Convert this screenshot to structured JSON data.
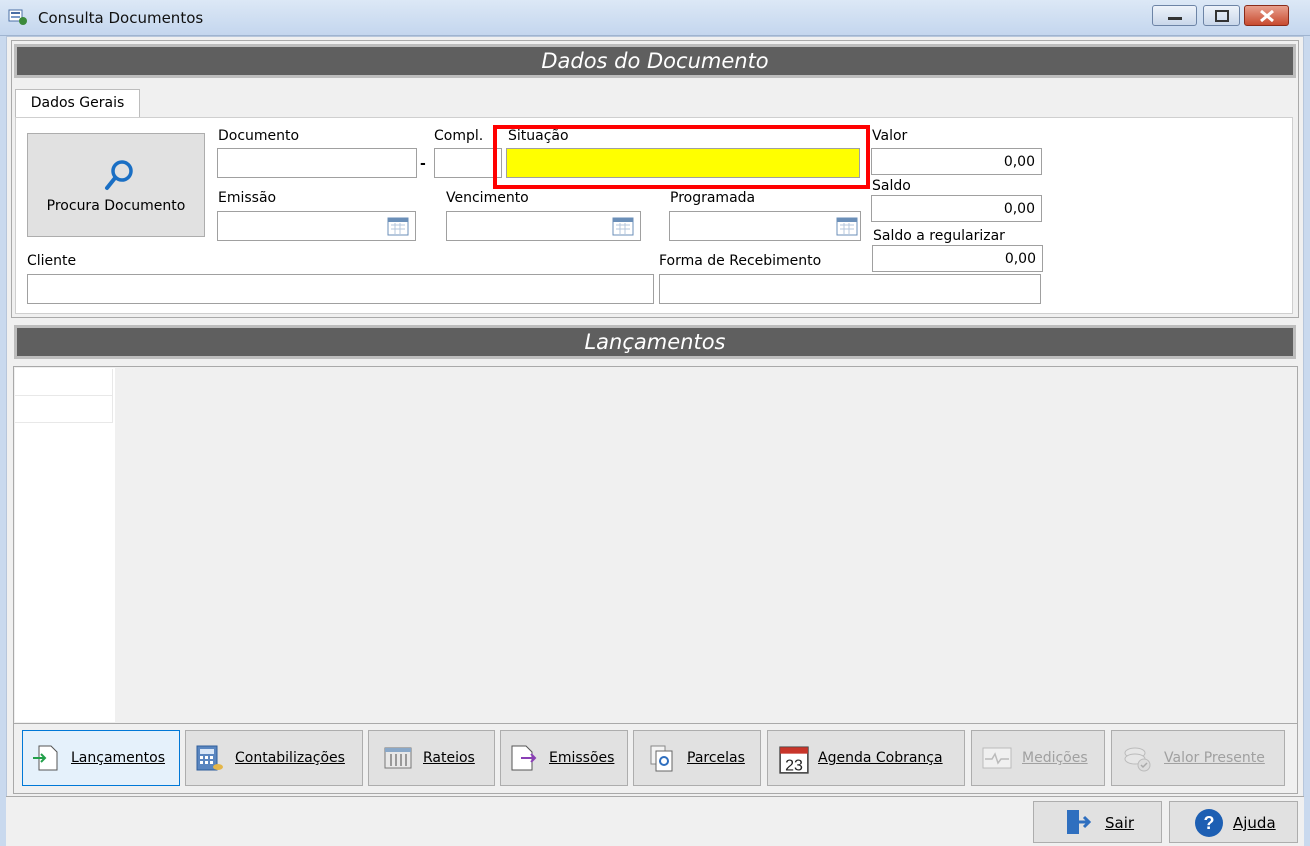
{
  "window": {
    "title": "Consulta Documentos"
  },
  "sections": {
    "document_header": "Dados do Documento",
    "entries_header": "Lançamentos"
  },
  "tabs": [
    {
      "label": "Dados Gerais",
      "active": true
    }
  ],
  "search_button": {
    "label": "Procura Documento"
  },
  "fields": {
    "documento": {
      "label": "Documento",
      "value": ""
    },
    "compl": {
      "label": "Compl.",
      "value": ""
    },
    "separator": "-",
    "situacao": {
      "label": "Situação",
      "value": "",
      "background": "#ffff00"
    },
    "valor": {
      "label": "Valor",
      "value": "0,00"
    },
    "saldo": {
      "label": "Saldo",
      "value": "0,00"
    },
    "saldo_regularizar": {
      "label": "Saldo a regularizar",
      "value": "0,00"
    },
    "emissao": {
      "label": "Emissão",
      "value": ""
    },
    "vencimento": {
      "label": "Vencimento",
      "value": ""
    },
    "programada": {
      "label": "Programada",
      "value": ""
    },
    "cliente": {
      "label": "Cliente",
      "value": ""
    },
    "forma_recebimento": {
      "label": "Forma de Recebimento",
      "value": ""
    }
  },
  "toolbar": [
    {
      "label": "Lançamentos",
      "icon": "entries-icon",
      "active": true,
      "enabled": true
    },
    {
      "label": "Contabilizações",
      "icon": "calculator-icon",
      "enabled": true
    },
    {
      "label": "Rateios",
      "icon": "split-icon",
      "enabled": true
    },
    {
      "label": "Emissões",
      "icon": "emissions-icon",
      "enabled": true
    },
    {
      "label": "Parcelas",
      "icon": "installments-icon",
      "enabled": true
    },
    {
      "label": "Agenda Cobrança",
      "icon": "calendar-icon",
      "calendar_day": "23",
      "enabled": true
    },
    {
      "label": "Medições",
      "icon": "measurement-icon",
      "enabled": false
    },
    {
      "label": "Valor Presente",
      "icon": "present-value-icon",
      "enabled": false
    }
  ],
  "footer": {
    "exit_label": "Sair",
    "help_label": "Ajuda"
  },
  "colors": {
    "header_bar": "#5f5f5f",
    "highlight": "#ff0000",
    "situacao_fill": "#ffff00",
    "active_button": "#0078d7"
  }
}
